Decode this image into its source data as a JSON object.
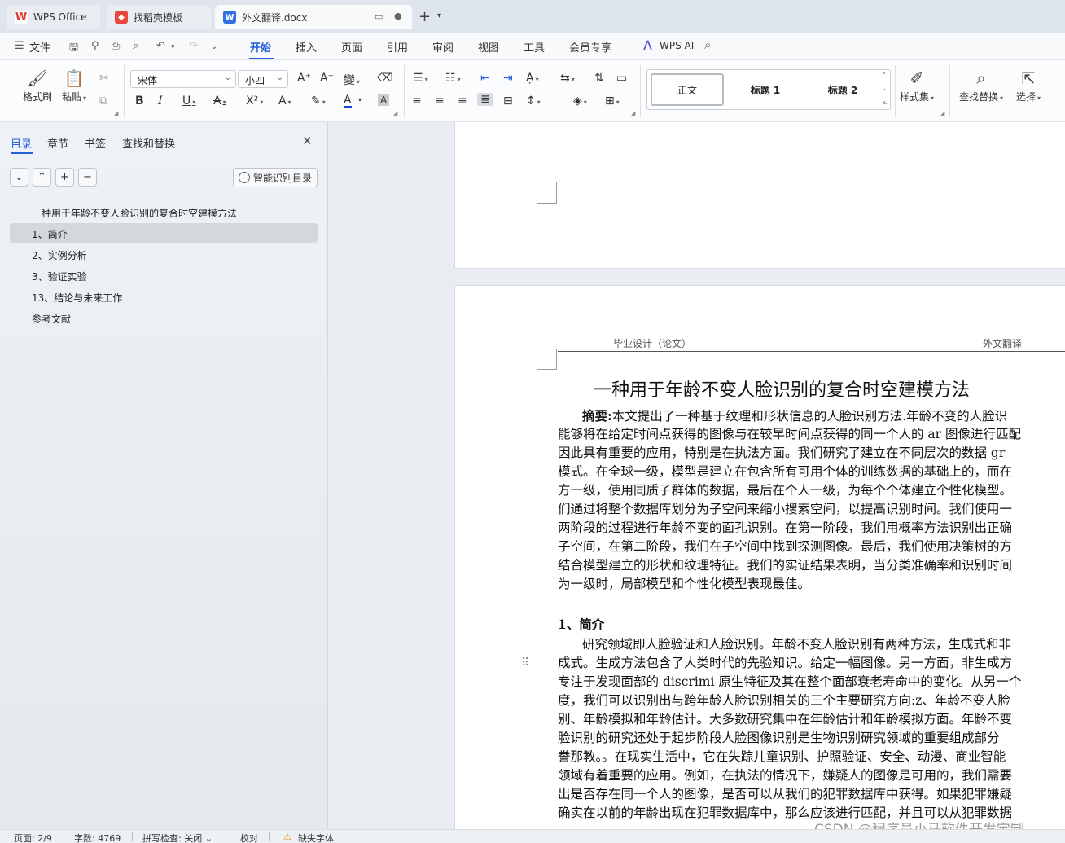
{
  "tabs": [
    {
      "label": "WPS Office",
      "icon": "wps-logo-icon"
    },
    {
      "label": "找稻壳模板",
      "icon": "docer-icon"
    },
    {
      "label": "外文翻译.docx",
      "icon": "word-doc-icon"
    }
  ],
  "menu": {
    "file": "文件",
    "items": [
      "开始",
      "插入",
      "页面",
      "引用",
      "审阅",
      "视图",
      "工具",
      "会员专享"
    ],
    "active": "开始",
    "ai": "WPS AI"
  },
  "ribbon": {
    "format_painter": "格式刷",
    "paste": "粘贴",
    "font_name": "宋体",
    "font_size": "小四",
    "styles": [
      "正文",
      "标题 1",
      "标题 2"
    ],
    "style_set": "样式集",
    "find_replace": "查找替换",
    "select": "选择"
  },
  "pane": {
    "tabs": [
      "目录",
      "章节",
      "书签",
      "查找和替换"
    ],
    "smart_toc": "智能识别目录",
    "toc": [
      {
        "label": "一种用于年龄不变人脸识别的复合时空建模方法",
        "selected": false
      },
      {
        "label": "1、简介",
        "selected": true
      },
      {
        "label": "2、实例分析",
        "selected": false
      },
      {
        "label": "3、验证实验",
        "selected": false
      },
      {
        "label": "13、结论与未来工作",
        "selected": false
      },
      {
        "label": "参考文献",
        "selected": false
      }
    ]
  },
  "document": {
    "header_left": "毕业设计（论文）",
    "header_right": "外文翻译",
    "title": "一种用于年龄不变人脸识别的复合时空建模方法",
    "abstract_label": "摘要:",
    "abstract_lines": [
      "本文提出了一种基于纹理和形状信息的人脸识别方法.年龄不变的人脸识",
      "能够将在给定时间点获得的图像与在较早时间点获得的同一个人的 ar 图像进行匹配",
      "因此具有重要的应用，特别是在执法方面。我们研究了建立在不同层次的数据 gr",
      "模式。在全球一级，模型是建立在包含所有可用个体的训练数据的基础上的，而在",
      "方一级，使用同质子群体的数据，最后在个人一级，为每个个体建立个性化模型。",
      "们通过将整个数据库划分为子空间来缩小搜索空间，以提高识别时间。我们使用一",
      "两阶段的过程进行年龄不变的面孔识别。在第一阶段，我们用概率方法识别出正确",
      "子空间，在第二阶段，我们在子空间中找到探测图像。最后，我们使用决策树的方",
      "结合模型建立的形状和纹理特征。我们的实证结果表明，当分类准确率和识别时间",
      "为一级时，局部模型和个性化模型表现最佳。"
    ],
    "section1_title": "1、简介",
    "section1_lines": [
      "研究领域即人脸验证和人脸识别。年龄不变人脸识别有两种方法，生成式和非",
      "成式。生成方法包含了人类时代的先验知识。给定一幅图像。另一方面，非生成方",
      "专注于发现面部的 discrimi 原生特征及其在整个面部衰老寿命中的变化。从另一个",
      "度，我们可以识别出与跨年龄人脸识别相关的三个主要研究方向:z、年龄不变人脸",
      "别、年龄模拟和年龄估计。大多数研究集中在年龄估计和年龄模拟方面。年龄不变",
      "脸识别的研究还处于起步阶段人脸图像识别是生物识别研究领域的重要组成部分",
      "誊那教。。在现实生活中，它在失踪儿童识别、护照验证、安全、动漫、商业智能",
      "领域有着重要的应用。例如，在执法的情况下，嫌疑人的图像是可用的，我们需要",
      "出是否存在同一个人的图像，是否可以从我们的犯罪数据库中获得。如果犯罪嫌疑",
      "确实在以前的年龄出现在犯罪数据库中，那么应该进行匹配，并且可以从犯罪数据"
    ]
  },
  "status": {
    "page": "页面: 2/9",
    "words": "字数: 4769",
    "spell": "拼写检查: 关闭",
    "proof": "校对",
    "missing_font": "缺失字体"
  },
  "watermark": "CSDN @程序员小马软件开发定制"
}
